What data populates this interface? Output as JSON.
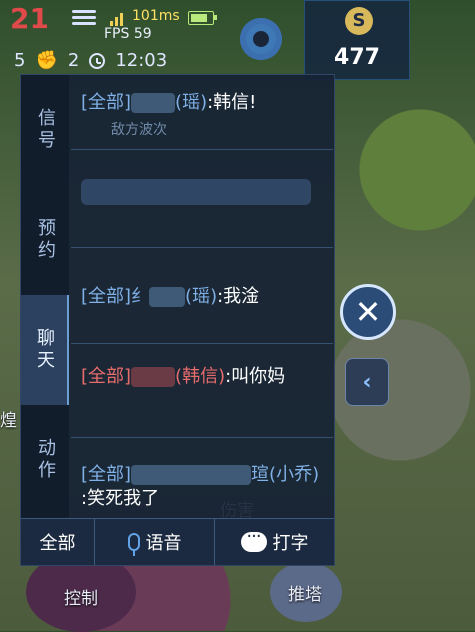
{
  "hud": {
    "red_counter": "21",
    "ping": "101ms",
    "fps": "FPS 59",
    "left_stat": "5",
    "fist_stat": "2",
    "clock_time": "12:03",
    "gold_amount": "477",
    "gold_icon_glyph": "S"
  },
  "tabs": [
    {
      "label": "信号"
    },
    {
      "label": "预约"
    },
    {
      "label": "聊天"
    },
    {
      "label": "动作"
    }
  ],
  "messages": [
    {
      "channel": "[全部]",
      "hero": "(瑶)",
      "text": ":韩信!"
    },
    {
      "ghost_text": "敌方波次"
    },
    {
      "channel": "[全部]",
      "prefix": "纟",
      "hero": "(瑶)",
      "text": ":我淦"
    },
    {
      "channel": "[全部]",
      "hero": "(韩信)",
      "text": ":叫你妈"
    },
    {
      "channel": "[全部]",
      "hero_end": "瑄(小乔)",
      "text": ":笑死我了"
    }
  ],
  "bottom_buttons": {
    "all_label": "全部",
    "voice_label": "语音",
    "type_label": "打字"
  },
  "skills": {
    "control": "控制",
    "damage": "伤害",
    "push": "推塔",
    "left_fragment": "煌"
  },
  "colors": {
    "channel_blue": "#7fb0e6",
    "channel_red": "#e86c6c",
    "panel_bg": "#16223a"
  }
}
